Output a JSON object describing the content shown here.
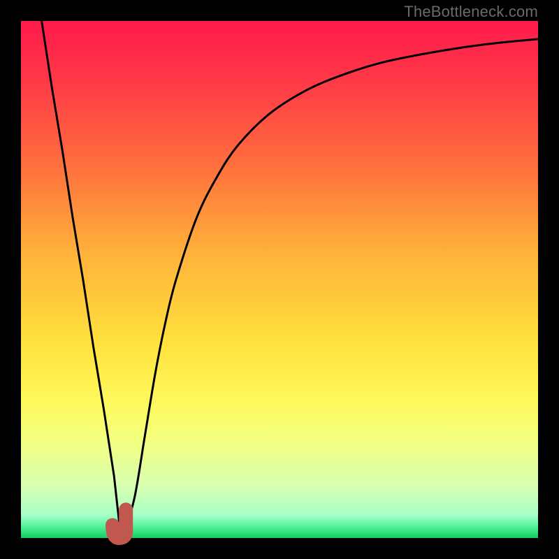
{
  "watermark": "TheBottleneck.com",
  "colors": {
    "frame": "#000000",
    "curve_stroke": "#000000",
    "marker_fill": "#c1584f",
    "gradient_stops": [
      {
        "offset": 0.0,
        "color": "#ff1a4b"
      },
      {
        "offset": 0.12,
        "color": "#ff3a47"
      },
      {
        "offset": 0.28,
        "color": "#ff6f3d"
      },
      {
        "offset": 0.45,
        "color": "#ffb23a"
      },
      {
        "offset": 0.62,
        "color": "#ffe13d"
      },
      {
        "offset": 0.73,
        "color": "#fff85a"
      },
      {
        "offset": 0.8,
        "color": "#f5ff7a"
      },
      {
        "offset": 0.9,
        "color": "#d8ffb0"
      },
      {
        "offset": 0.955,
        "color": "#a8ffc8"
      },
      {
        "offset": 0.975,
        "color": "#5cf5a0"
      },
      {
        "offset": 0.99,
        "color": "#2de07a"
      },
      {
        "offset": 1.0,
        "color": "#18c75e"
      }
    ]
  },
  "chart_data": {
    "type": "line",
    "title": "",
    "xlabel": "",
    "ylabel": "",
    "xlim": [
      0,
      100
    ],
    "ylim": [
      0,
      100
    ],
    "grid": false,
    "series": [
      {
        "name": "bottleneck-curve",
        "x": [
          4,
          6,
          8,
          10,
          12,
          14,
          16,
          18,
          19,
          20,
          22,
          24,
          26,
          28,
          30,
          34,
          38,
          42,
          48,
          55,
          62,
          70,
          80,
          90,
          100
        ],
        "values": [
          100,
          87,
          75,
          62,
          50,
          37,
          25,
          12,
          3,
          1,
          8,
          20,
          32,
          42,
          50,
          62,
          70,
          76,
          82,
          86.5,
          89.5,
          92,
          94,
          95.5,
          96.5
        ]
      }
    ],
    "marker": {
      "name": "optimum-J",
      "x": 19.3,
      "y_bottom": 0.5,
      "y_top": 5.5,
      "shape": "J"
    }
  }
}
